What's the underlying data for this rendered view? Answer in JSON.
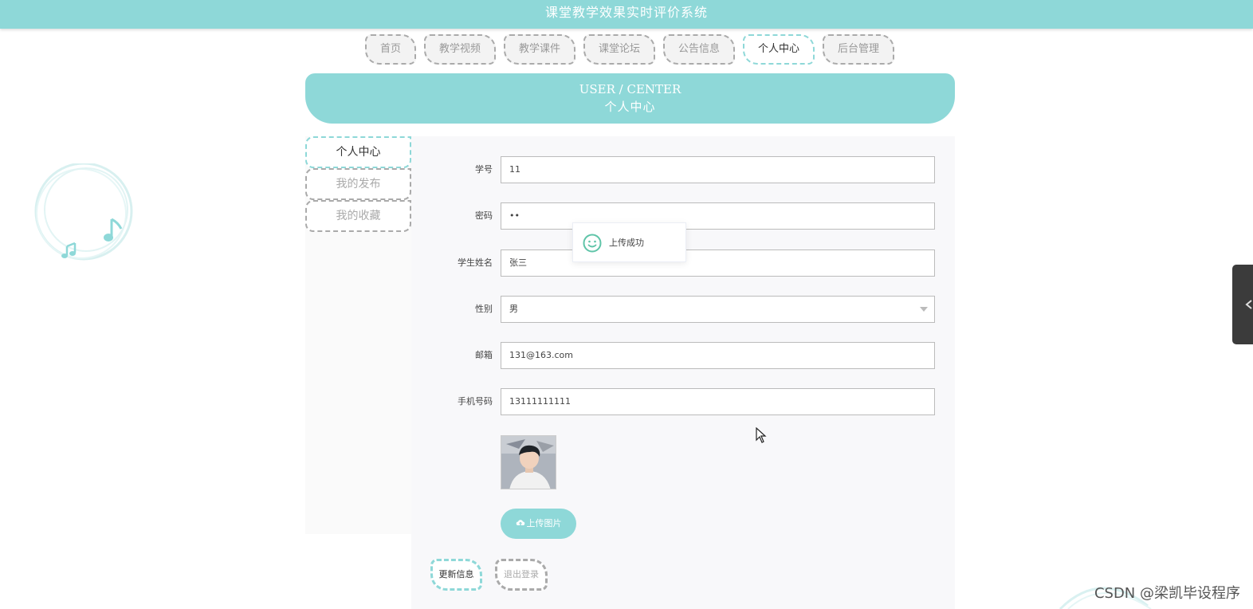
{
  "app": {
    "title": "课堂教学效果实时评价系统"
  },
  "nav": {
    "tabs": [
      {
        "label": "首页",
        "active": false
      },
      {
        "label": "教学视频",
        "active": false
      },
      {
        "label": "教学课件",
        "active": false
      },
      {
        "label": "课堂论坛",
        "active": false
      },
      {
        "label": "公告信息",
        "active": false
      },
      {
        "label": "个人中心",
        "active": true
      },
      {
        "label": "后台管理",
        "active": false
      }
    ]
  },
  "banner": {
    "en": "USER / CENTER",
    "cn": "个人中心"
  },
  "sidebar": {
    "items": [
      {
        "label": "个人中心",
        "active": true
      },
      {
        "label": "我的发布",
        "active": false
      },
      {
        "label": "我的收藏",
        "active": false
      }
    ]
  },
  "form": {
    "student_id": {
      "label": "学号",
      "value": "11"
    },
    "password": {
      "label": "密码",
      "value": "••"
    },
    "name": {
      "label": "学生姓名",
      "value": "张三"
    },
    "gender": {
      "label": "性别",
      "value": "男"
    },
    "email": {
      "label": "邮箱",
      "value": "131@163.com"
    },
    "phone": {
      "label": "手机号码",
      "value": "13111111111"
    },
    "upload_label": "上传图片",
    "update_label": "更新信息",
    "logout_label": "退出登录"
  },
  "toast": {
    "message": "上传成功",
    "icon": "smile-icon"
  },
  "watermark": "CSDN @梁凯毕设程序",
  "colors": {
    "accent": "#8ed8d8",
    "border_dashed": "#aaaaaa",
    "panel_bg": "#f8f8fa"
  }
}
